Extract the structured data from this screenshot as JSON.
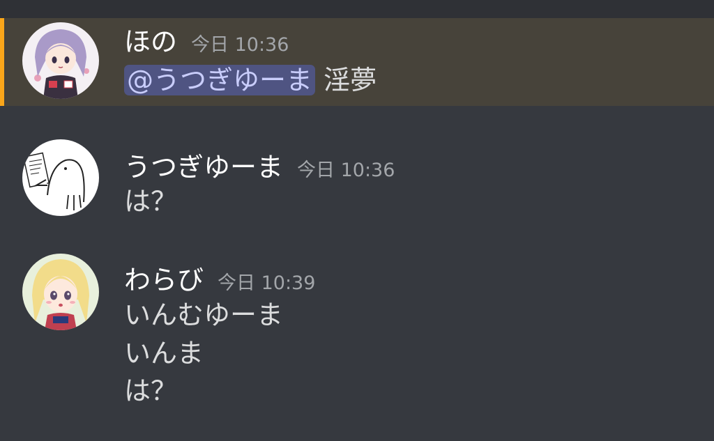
{
  "messages": [
    {
      "author": "ほの",
      "timestamp": "今日 10:36",
      "avatar": "purple-haired-anime-girl-avatar",
      "mentioned": true,
      "content": {
        "mention": "@うつぎゆーま",
        "text": "淫夢"
      }
    },
    {
      "author": "うつぎゆーま",
      "timestamp": "今日 10:36",
      "avatar": "bird-sketch-avatar",
      "lines": [
        "は？"
      ]
    },
    {
      "author": "わらび",
      "timestamp": "今日 10:39",
      "avatar": "blonde-anime-girl-avatar",
      "lines": [
        "いんむゆーま",
        "いんま",
        "は？"
      ]
    }
  ],
  "colors": {
    "background": "#36393f",
    "mention_highlight_bg": "#47433a",
    "mention_bar": "#faa61a",
    "mention_pill_bg": "#4f5482",
    "mention_pill_text": "#c9cdfb",
    "username": "#ffffff",
    "timestamp": "#a3a6aa",
    "message_text": "#dcddde"
  }
}
